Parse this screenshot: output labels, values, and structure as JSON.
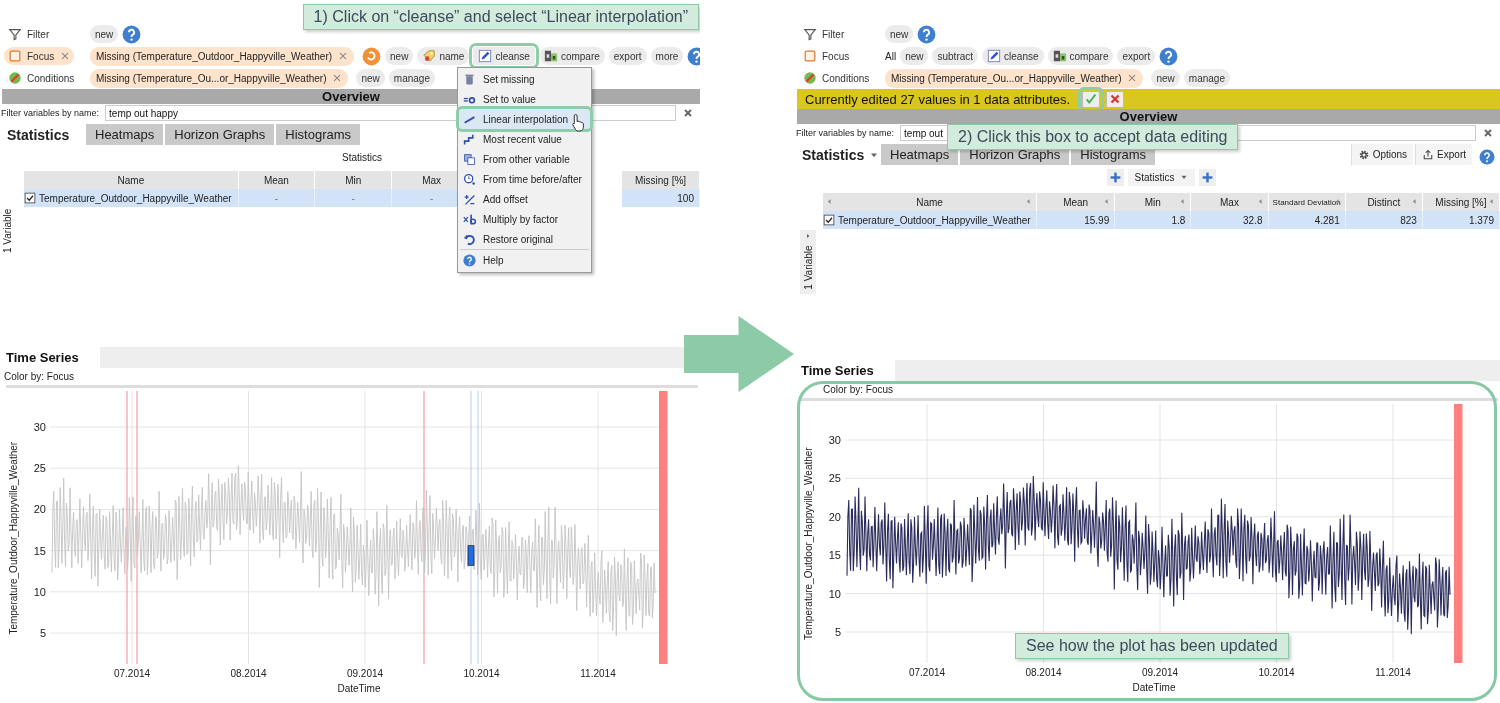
{
  "panels": [
    {
      "callouts": [
        {
          "kind": "header",
          "text": "1) Click on “cleanse” and select “Linear interpolation”"
        }
      ],
      "toolbar": {
        "rows": [
          {
            "label": "Filter",
            "removable": false,
            "items": [
              {
                "kind": "plain",
                "text": "new",
                "highlighted": false
              },
              {
                "kind": "help"
              }
            ]
          },
          {
            "label": "Focus",
            "removable": true,
            "items": [
              {
                "kind": "tag",
                "text": "Missing (Temperature_Outdoor_Happyville_Weather)"
              },
              {
                "kind": "reset"
              },
              {
                "kind": "plain",
                "text": "new",
                "highlighted": false
              },
              {
                "kind": "tagged",
                "text": "name",
                "highlighted": false
              },
              {
                "kind": "edit",
                "text": "cleanse",
                "highlighted": true
              },
              {
                "kind": "compare",
                "text": "compare",
                "highlighted": false
              },
              {
                "kind": "plain",
                "text": "export",
                "highlighted": false
              },
              {
                "kind": "plain",
                "text": "more",
                "highlighted": false
              },
              {
                "kind": "help"
              }
            ]
          },
          {
            "label": "Conditions",
            "removable": false,
            "items": [
              {
                "kind": "tag",
                "text": "Missing (Temperature_Ou...or_Happyville_Weather)"
              },
              {
                "kind": "plain",
                "text": "new",
                "highlighted": false
              },
              {
                "kind": "plain",
                "text": "manage",
                "highlighted": false
              }
            ]
          }
        ]
      },
      "overview": {
        "title": "Overview",
        "filter_label": "Filter variables by name:",
        "filter_value": "temp out happy",
        "tabs": [
          {
            "label": "Statistics",
            "selected": true,
            "dropdown": false
          },
          {
            "label": "Heatmaps",
            "selected": false,
            "dropdown": false
          },
          {
            "label": "Horizon Graphs",
            "selected": false,
            "dropdown": false
          },
          {
            "label": "Histograms",
            "selected": false,
            "dropdown": false
          }
        ]
      },
      "stats": {
        "caption": "Statistics",
        "sortable": false,
        "columns": [
          "Name",
          "Mean",
          "Min",
          "Max",
          "Missing [%]"
        ],
        "rows": [
          {
            "checked": true,
            "selected": true,
            "cells": [
              "Temperature_Outdoor_Happyville_Weather",
              "-",
              "-",
              "-",
              "100"
            ]
          }
        ],
        "side_label": {
          "text": "1 Variable",
          "collapsible": false
        }
      },
      "menu": {
        "items": [
          {
            "text": "Set missing",
            "selected": false
          },
          {
            "text": "Set to value",
            "selected": false
          },
          {
            "text": "Linear interpolation",
            "selected": true
          },
          {
            "text": "Most recent value",
            "selected": false
          },
          {
            "text": "From other variable",
            "selected": false
          },
          {
            "text": "From time before/after",
            "selected": false
          },
          {
            "text": "Add offset",
            "selected": false
          },
          {
            "text": "Multiply by factor",
            "selected": false
          },
          {
            "text": "Restore original",
            "selected": false
          },
          {
            "text": "Help",
            "selected": false
          }
        ]
      },
      "time_series": {
        "tab": "Time Series",
        "color_by": "Color by: Focus",
        "ylabel": "Temperature_Outdoor_Happyville_Weather",
        "xlabel": "DateTime",
        "yticks": [
          "30",
          "25",
          "20",
          "15",
          "10",
          "5"
        ],
        "xticks": [
          "07.2014",
          "08.2014",
          "09.2014",
          "10.2014",
          "11.2014"
        ],
        "dimmed": true,
        "show_gaps": true,
        "framed": false
      }
    },
    {
      "callouts": [
        {
          "kind": "field",
          "text": "2) Click this box to accept data editing"
        },
        {
          "kind": "chart",
          "text": "See how the plot has been updated"
        }
      ],
      "toolbar": {
        "rows": [
          {
            "label": "Filter",
            "removable": false,
            "items": [
              {
                "kind": "plain",
                "text": "new",
                "highlighted": false
              },
              {
                "kind": "help"
              }
            ]
          },
          {
            "label": "Focus",
            "removable": false,
            "items": [
              {
                "kind": "text",
                "text": "All"
              },
              {
                "kind": "plain",
                "text": "new",
                "highlighted": false
              },
              {
                "kind": "plain",
                "text": "subtract",
                "highlighted": false
              },
              {
                "kind": "edit",
                "text": "cleanse",
                "highlighted": false
              },
              {
                "kind": "compare",
                "text": "compare",
                "highlighted": false
              },
              {
                "kind": "plain",
                "text": "export",
                "highlighted": false
              },
              {
                "kind": "help"
              }
            ]
          },
          {
            "label": "Conditions",
            "removable": false,
            "items": [
              {
                "kind": "tag",
                "text": "Missing (Temperature_Ou...or_Happyville_Weather)"
              },
              {
                "kind": "plain",
                "text": "new",
                "highlighted": false
              },
              {
                "kind": "plain",
                "text": "manage",
                "highlighted": false
              }
            ]
          }
        ]
      },
      "edit_bar": {
        "text": "Currently edited 27 values in 1 data attributes.",
        "actions": [
          {
            "kind": "accept",
            "highlighted": true
          },
          {
            "kind": "reject",
            "highlighted": false
          }
        ]
      },
      "overview": {
        "title": "Overview",
        "filter_label": "Filter variables by name:",
        "filter_value": "temp out",
        "tabs": [
          {
            "label": "Statistics",
            "selected": true,
            "dropdown": true
          },
          {
            "label": "Heatmaps",
            "selected": false,
            "dropdown": false
          },
          {
            "label": "Horizon Graphs",
            "selected": false,
            "dropdown": false
          },
          {
            "label": "Histograms",
            "selected": false,
            "dropdown": false
          }
        ],
        "actions": [
          {
            "kind": "options",
            "text": "Options"
          },
          {
            "kind": "export",
            "text": "Export"
          },
          {
            "kind": "help"
          }
        ]
      },
      "stats": {
        "toolbar_label": "Statistics",
        "sortable": true,
        "columns": [
          "Name",
          "Mean",
          "Min",
          "Max",
          "Standard Deviation",
          "Distinct",
          "Missing [%]"
        ],
        "rows": [
          {
            "checked": true,
            "selected": true,
            "cells": [
              "Temperature_Outdoor_Happyville_Weather",
              "15.99",
              "1.8",
              "32.8",
              "4.281",
              "823",
              "1.379"
            ]
          }
        ],
        "side_label": {
          "text": "1 Variable",
          "collapsible": true
        }
      },
      "time_series": {
        "tab": "Time Series",
        "color_by": "Color by: Focus",
        "ylabel": "Temperature_Outdoor_Happyville_Weather",
        "xlabel": "DateTime",
        "yticks": [
          "30",
          "25",
          "20",
          "15",
          "10",
          "5"
        ],
        "xticks": [
          "07.2014",
          "08.2014",
          "09.2014",
          "10.2014",
          "11.2014"
        ],
        "dimmed": false,
        "show_gaps": false,
        "framed": true
      }
    }
  ]
}
